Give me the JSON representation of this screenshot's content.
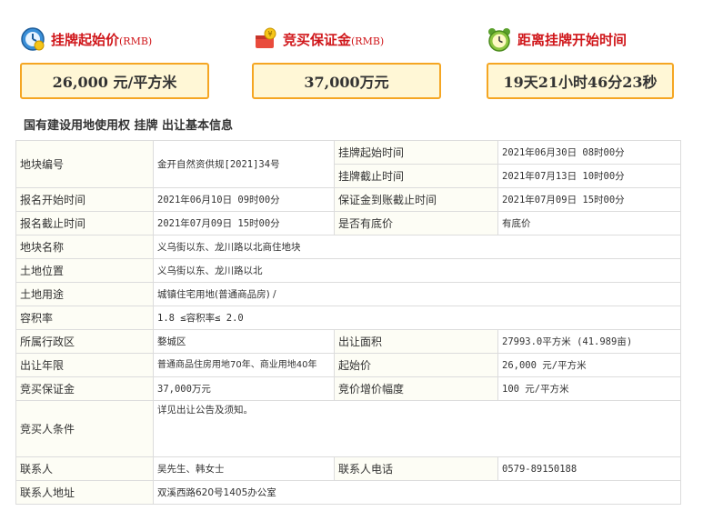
{
  "summary": {
    "start_price": {
      "title": "挂牌起始价",
      "unit_tag": "(RMB)",
      "value": "26,000 元/平方米"
    },
    "deposit": {
      "title": "竞买保证金",
      "unit_tag": "(RMB)",
      "value": "37,000万元"
    },
    "countdown": {
      "title": "距离挂牌开始时间",
      "value": "19天21小时46分23秒"
    }
  },
  "section_title": "国有建设用地使用权 挂牌 出让基本信息",
  "table": {
    "plot_no_label": "地块编号",
    "plot_no": "金开自然资供规[2021]34号",
    "listing_start_label": "挂牌起始时间",
    "listing_start": "2021年06月30日 08时00分",
    "listing_end_label": "挂牌截止时间",
    "listing_end": "2021年07月13日 10时00分",
    "signup_start_label": "报名开始时间",
    "signup_start": "2021年06月10日 09时00分",
    "deposit_deadline_label": "保证金到账截止时间",
    "deposit_deadline": "2021年07月09日 15时00分",
    "signup_end_label": "报名截止时间",
    "signup_end": "2021年07月09日 15时00分",
    "reserve_label": "是否有底价",
    "reserve": "有底价",
    "name_label": "地块名称",
    "name": "义乌街以东、龙川路以北商住地块",
    "location_label": "土地位置",
    "location": "义乌街以东、龙川路以北",
    "usage_label": "土地用途",
    "usage": "城镇住宅用地(普通商品房) /",
    "far_label": "容积率",
    "far": "1.8 ≤容积率≤ 2.0",
    "district_label": "所属行政区",
    "district": "婺城区",
    "area_label": "出让面积",
    "area": "27993.0平方米 (41.989亩)",
    "term_label": "出让年限",
    "term": "普通商品住房用地70年、商业用地40年",
    "start_price_label": "起始价",
    "start_price": "26,000 元/平方米",
    "deposit_label": "竞买保证金",
    "deposit": "37,000万元",
    "increment_label": "竞价增价幅度",
    "increment": "100 元/平方米",
    "conditions_label": "竞买人条件",
    "conditions": "详见出让公告及须知。",
    "contact_label": "联系人",
    "contact": "吴先生、韩女士",
    "phone_label": "联系人电话",
    "phone": "0579-89150188",
    "address_label": "联系人地址",
    "address": "双溪西路620号1405办公室"
  },
  "colors": {
    "title_red": "#d0171b",
    "box_border": "#f5a623",
    "box_bg": "#fff7d6",
    "border": "#dcdcdc"
  },
  "icons": [
    "price-clock-icon",
    "deposit-coin-icon",
    "alarm-clock-icon"
  ]
}
